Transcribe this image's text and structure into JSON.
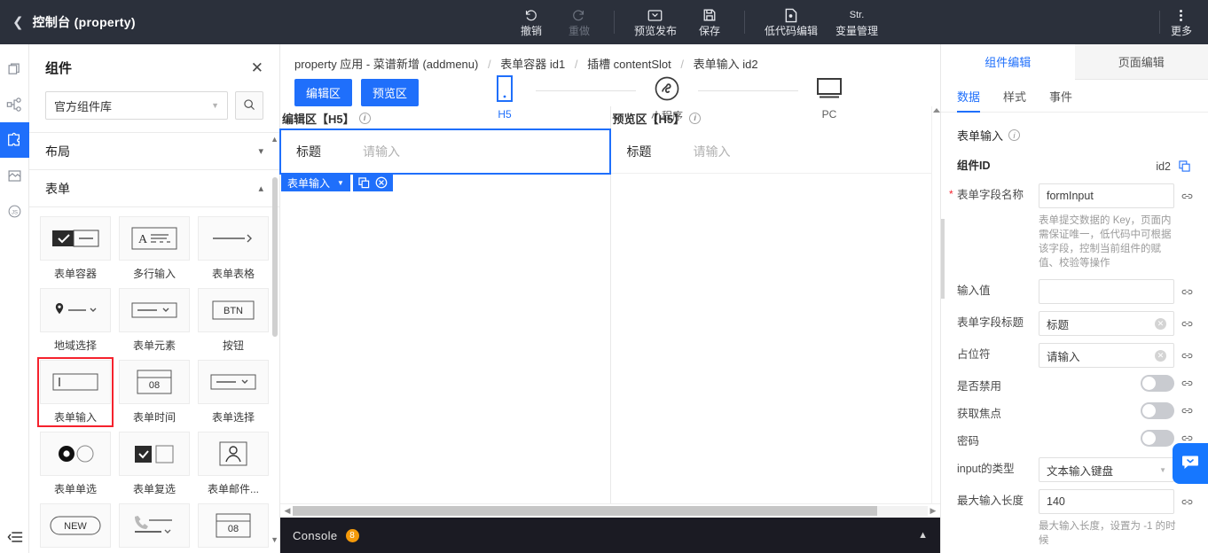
{
  "topbar": {
    "back_icon": "chevron-left-icon",
    "title": "控制台 (property)",
    "items": [
      {
        "icon": "undo-icon",
        "label": "撤销",
        "disabled": false
      },
      {
        "icon": "redo-icon",
        "label": "重做",
        "disabled": true
      },
      {
        "icon": "preview-publish-icon",
        "label": "预览发布",
        "disabled": false
      },
      {
        "icon": "save-icon",
        "label": "保存",
        "disabled": false
      },
      {
        "icon": "lowcode-edit-icon",
        "label": "低代码编辑",
        "disabled": false
      },
      {
        "icon": "variable-icon",
        "label": "变量管理",
        "disabled": false,
        "glyph": "Str."
      }
    ],
    "more_label": "更多"
  },
  "rail": {
    "items": [
      {
        "icon": "pages-icon",
        "name": "pages",
        "active": false
      },
      {
        "icon": "sitemap-icon",
        "name": "structure",
        "active": false
      },
      {
        "icon": "puzzle-icon",
        "name": "components",
        "active": true
      },
      {
        "icon": "media-icon",
        "name": "media",
        "active": false
      },
      {
        "icon": "js-icon",
        "name": "scripts",
        "active": false
      }
    ],
    "collapse_icon": "collapse-panel-icon"
  },
  "component_panel": {
    "title": "组件",
    "close_icon": "close-icon",
    "library_select": "官方组件库",
    "search_icon": "search-icon",
    "sections": [
      {
        "title": "布局",
        "expanded": false,
        "items": []
      },
      {
        "title": "表单",
        "expanded": true,
        "items": [
          {
            "label": "表单容器",
            "icon": "form-container-icon",
            "selected": false
          },
          {
            "label": "多行输入",
            "icon": "textarea-icon",
            "selected": false
          },
          {
            "label": "表单表格",
            "icon": "form-table-icon",
            "selected": false
          },
          {
            "label": "地域选择",
            "icon": "region-picker-icon",
            "selected": false
          },
          {
            "label": "表单元素",
            "icon": "form-element-icon",
            "selected": false
          },
          {
            "label": "按钮",
            "icon": "button-icon",
            "glyph": "BTN",
            "selected": false
          },
          {
            "label": "表单输入",
            "icon": "form-input-icon",
            "selected": true
          },
          {
            "label": "表单时间",
            "icon": "form-time-icon",
            "glyph": "08",
            "selected": false
          },
          {
            "label": "表单选择",
            "icon": "form-select-icon",
            "selected": false
          },
          {
            "label": "表单单选",
            "icon": "form-radio-icon",
            "selected": false
          },
          {
            "label": "表单复选",
            "icon": "form-checkbox-icon",
            "selected": false
          },
          {
            "label": "表单邮件...",
            "icon": "form-mail-icon",
            "selected": false
          },
          {
            "label": "",
            "icon": "new-badge-icon",
            "glyph": "NEW",
            "selected": false
          },
          {
            "label": "",
            "icon": "phone-icon",
            "selected": false
          },
          {
            "label": "",
            "icon": "form-time2-icon",
            "glyph": "08",
            "selected": false
          }
        ]
      }
    ]
  },
  "center": {
    "breadcrumb": [
      {
        "text": "property 应用 - 菜谱新增 (addmenu)",
        "dim": false
      },
      {
        "text": "表单容器 id1",
        "dim": false
      },
      {
        "text": "插槽 contentSlot",
        "dim": false
      },
      {
        "text": "表单输入 id2",
        "dim": false
      }
    ],
    "mode_buttons": [
      {
        "label": "编辑区",
        "active": true
      },
      {
        "label": "预览区",
        "active": true
      }
    ],
    "devices": [
      {
        "label": "H5",
        "icon": "mobile-icon",
        "active": true
      },
      {
        "label": "小程序",
        "icon": "miniprogram-icon",
        "active": false
      },
      {
        "label": "PC",
        "icon": "desktop-icon",
        "active": false
      }
    ],
    "edit_pane": {
      "header": "编辑区【H5】",
      "info_icon": "info-icon",
      "field_label": "标题",
      "field_placeholder": "请输入",
      "selection_badge": "表单输入",
      "badge_caret": "chevron-down-icon",
      "badge_copy_icon": "copy-icon",
      "badge_close_icon": "close-circle-icon"
    },
    "preview_pane": {
      "header": "预览区【H5】",
      "info_icon": "info-icon",
      "field_label": "标题",
      "field_placeholder": "请输入"
    },
    "console": {
      "label": "Console",
      "badge": "8",
      "chevron": "chevron-up-icon"
    }
  },
  "right_panel": {
    "tabs": [
      {
        "label": "组件编辑",
        "active": true
      },
      {
        "label": "页面编辑",
        "active": false
      }
    ],
    "subtabs": [
      {
        "label": "数据",
        "active": true
      },
      {
        "label": "样式",
        "active": false
      },
      {
        "label": "事件",
        "active": false
      }
    ],
    "section_title": "表单输入",
    "section_info_icon": "info-icon",
    "fields": [
      {
        "type": "readonly",
        "label": "组件ID",
        "value": "id2",
        "icon": "copy-icon"
      },
      {
        "type": "text",
        "label": "表单字段名称",
        "required": true,
        "value": "formInput",
        "placeholder": "",
        "clearable": false,
        "link_icon": "link-icon",
        "hint": "表单提交数据的 Key，页面内需保证唯一，低代码中可根据该字段，控制当前组件的赋值、校验等操作"
      },
      {
        "type": "text",
        "label": "输入值",
        "required": false,
        "value": "",
        "placeholder": "",
        "clearable": false,
        "link_icon": "link-icon"
      },
      {
        "type": "text",
        "label": "表单字段标题",
        "required": false,
        "value": "标题",
        "clearable": true,
        "link_icon": "link-icon"
      },
      {
        "type": "text",
        "label": "占位符",
        "required": false,
        "value": "请输入",
        "clearable": true,
        "link_icon": "link-icon"
      },
      {
        "type": "toggle",
        "label": "是否禁用",
        "value": false,
        "link_icon": "link-icon"
      },
      {
        "type": "toggle",
        "label": "获取焦点",
        "value": false,
        "link_icon": "link-icon"
      },
      {
        "type": "toggle",
        "label": "密码",
        "value": false,
        "link_icon": "link-icon"
      },
      {
        "type": "select",
        "label": "input的类型",
        "value": "文本输入键盘",
        "link_icon": "link-icon"
      },
      {
        "type": "text",
        "label": "最大输入长度",
        "required": false,
        "value": "140",
        "clearable": false,
        "link_icon": "link-icon",
        "hint": "最大输入长度，设置为 -1 的时候"
      }
    ],
    "chat_fab_icon": "chat-bubble-icon"
  },
  "colors": {
    "accent": "#1f6ffb",
    "topbar_bg": "#2b303b",
    "console_bg": "#1b1b23",
    "badge_orange": "#f59a0a",
    "select_red": "#f5222d"
  }
}
